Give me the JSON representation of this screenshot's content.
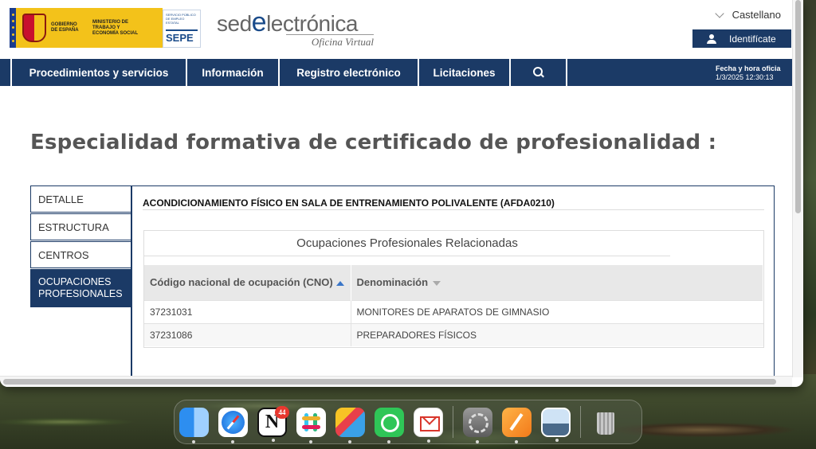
{
  "header": {
    "gov_text": "GOBIERNO DE ESPAÑA",
    "ministry_text": "MINISTERIO DE TRABAJO Y ECONOMÍA SOCIAL",
    "sepe_small": "SERVICIO PÚBLICO DE EMPLEO ESTATAL",
    "sepe_label": "SEPE",
    "sede_prefix": "sed",
    "sede_e": "e",
    "sede_suffix": "lectrónica",
    "sede_sub": "Oficina Virtual",
    "language": "Castellano",
    "login_label": "Identifícate"
  },
  "nav": {
    "items": [
      "Procedimientos y servicios",
      "Información",
      "Registro electrónico",
      "Licitaciones"
    ],
    "datetime_label": "Fecha y hora oficia",
    "datetime_value": "1/3/2025 12:30:13"
  },
  "main": {
    "title": "Especialidad formativa de certificado de profesionalidad :",
    "tabs": [
      "DETALLE",
      "ESTRUCTURA",
      "CENTROS",
      "OCUPACIONES PROFESIONALES"
    ],
    "specialty_name": "ACONDICIONAMIENTO FÍSICO EN SALA DE ENTRENAMIENTO POLIVALENTE (AFDA0210)",
    "occupations_title": "Ocupaciones Profesionales Relacionadas",
    "table": {
      "col_code": "Código nacional de ocupación (CNO)",
      "col_name": "Denominación",
      "rows": [
        {
          "code": "37231031",
          "name": "MONITORES DE APARATOS DE GIMNASIO"
        },
        {
          "code": "37231086",
          "name": "PREPARADORES FÍSICOS"
        }
      ]
    }
  },
  "dock": {
    "notion_badge": "44",
    "notion_glyph": "N"
  },
  "colors": {
    "brand_navy": "#1b3a66",
    "gov_yellow": "#f3c21a"
  }
}
